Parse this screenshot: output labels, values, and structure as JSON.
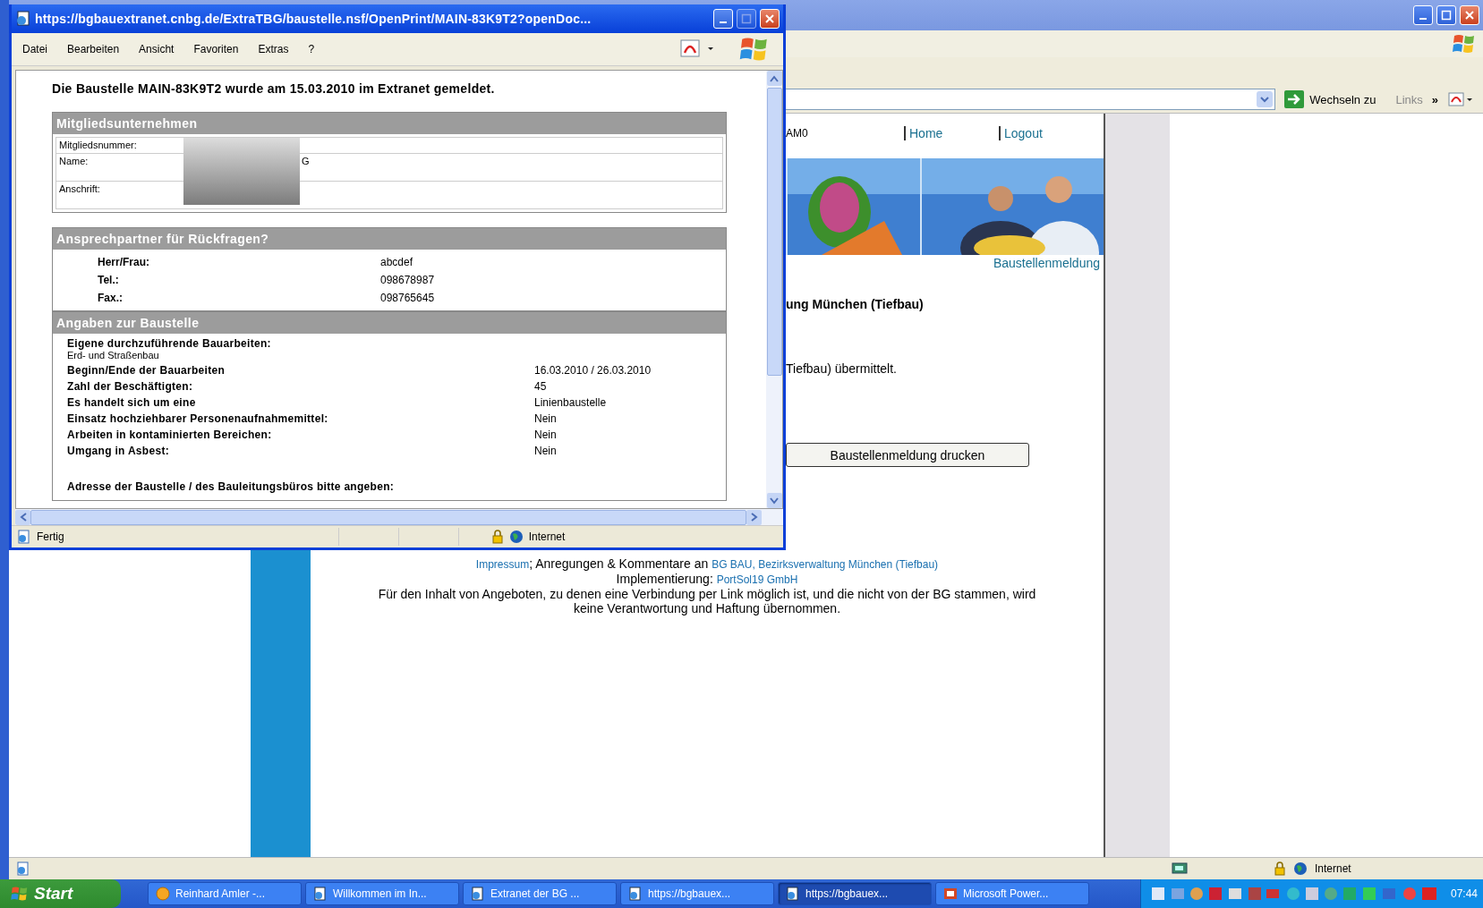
{
  "browser": {
    "go_label": "Wechseln zu",
    "links_label": "Links",
    "links_more": "»",
    "zone": "Internet",
    "page": {
      "user": "AM0",
      "nav": [
        "Home",
        "Logout"
      ],
      "banner_caption": "Baustellenmeldung",
      "heading": "ung München (Tiefbau)",
      "message": "Tiefbau) übermittelt.",
      "print_button": "Baustellenmeldung drucken",
      "footer": {
        "impressum": "Impressum",
        "sep": "; Anregungen & Kommentare an ",
        "contact": "BG BAU, Bezirksverwaltung München (Tiefbau)",
        "impl_label": "Implementierung: ",
        "impl_link": "PortSol19 GmbH",
        "disclaimer": "Für den Inhalt von Angeboten, zu denen eine Verbindung per Link möglich ist, und die nicht von der BG stammen, wird keine Verantwortung und Haftung übernommen."
      }
    }
  },
  "popup": {
    "title": "https://bgbauextranet.cnbg.de/ExtraTBG/baustelle.nsf/OpenPrint/MAIN-83K9T2?openDoc...",
    "menu": [
      "Datei",
      "Bearbeiten",
      "Ansicht",
      "Favoriten",
      "Extras",
      "?"
    ],
    "heading": "Die Baustelle MAIN-83K9T2 wurde am 15.03.2010 im Extranet gemeldet.",
    "sections": [
      {
        "title": "Mitgliedsunternehmen",
        "kind": "boxed",
        "rows": [
          {
            "label": "Mitgliedsnummer:"
          },
          {
            "label": "Name:",
            "value": "G"
          },
          {
            "label": "Anschrift:"
          }
        ]
      },
      {
        "title": "Ansprechpartner für Rückfragen?",
        "kind": "pairs",
        "rows": [
          {
            "label": "Herr/Frau:",
            "value": "abcdef"
          },
          {
            "label": "Tel.:",
            "value": "098678987"
          },
          {
            "label": "Fax.:",
            "value": "098765645"
          }
        ]
      },
      {
        "title": "Angaben zur Baustelle",
        "kind": "details",
        "rows": [
          {
            "label": "Eigene durchzuführende Bauarbeiten:",
            "note": "Erd- und Straßenbau"
          },
          {
            "label": "Beginn/Ende der Bauarbeiten",
            "value": "16.03.2010 / 26.03.2010"
          },
          {
            "label": "Zahl der Beschäftigten:",
            "value": "45"
          },
          {
            "label": "Es handelt sich um eine",
            "value": "Linienbaustelle"
          },
          {
            "label": "Einsatz hochziehbarer Personenaufnahmemittel:",
            "value": "Nein"
          },
          {
            "label": "Arbeiten in kontaminierten Bereichen:",
            "value": "Nein"
          },
          {
            "label": "Umgang in Asbest:",
            "value": "Nein"
          },
          {
            "label": "Adresse der Baustelle / des Bauleitungsbüros bitte angeben:",
            "gap": true
          }
        ]
      }
    ],
    "status": "Fertig",
    "zone": "Internet"
  },
  "taskbar": {
    "start": "Start",
    "tasks": [
      {
        "label": "Reinhard Amler -...",
        "kind": "mail",
        "selected": false
      },
      {
        "label": "Willkommen im In...",
        "kind": "browser",
        "selected": false
      },
      {
        "label": "Extranet der BG ...",
        "kind": "browser",
        "selected": false
      },
      {
        "label": "https://bgbauex...",
        "kind": "browser",
        "selected": false
      },
      {
        "label": "https://bgbauex...",
        "kind": "browser",
        "selected": true
      },
      {
        "label": "Microsoft Power...",
        "kind": "slides",
        "selected": false
      }
    ],
    "clock": "07:44"
  }
}
